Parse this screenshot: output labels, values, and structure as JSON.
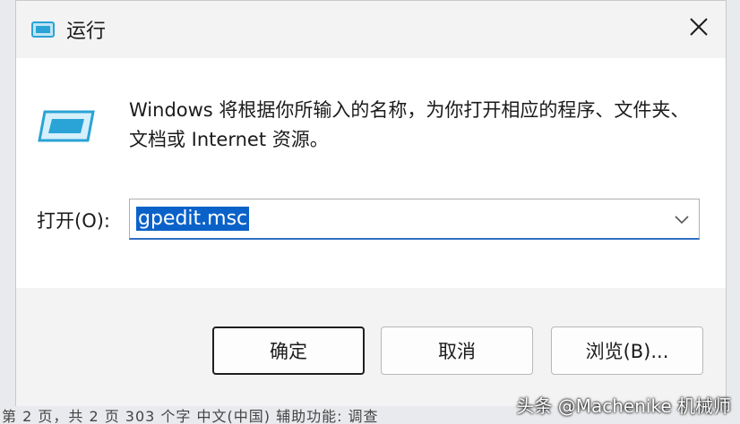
{
  "window": {
    "title": "运行",
    "title_icon": "run-window-icon",
    "close_icon": "close-icon"
  },
  "content": {
    "description": "Windows 将根据你所输入的名称，为你打开相应的程序、文件夹、文档或 Internet 资源。",
    "open_label": "打开(O):",
    "input_value": "gpedit.msc",
    "dropdown_icon": "chevron-down-icon"
  },
  "buttons": {
    "ok": "确定",
    "cancel": "取消",
    "browse": "浏览(B)..."
  },
  "taskbar": {
    "status_text": "第 2 页，共 2 页  303 个字  中文(中国)  辅助功能: 调查"
  },
  "watermark": "头条 @Machenike 机械师",
  "colors": {
    "accent": "#0a62c9",
    "icon": "#2aa3d6"
  }
}
